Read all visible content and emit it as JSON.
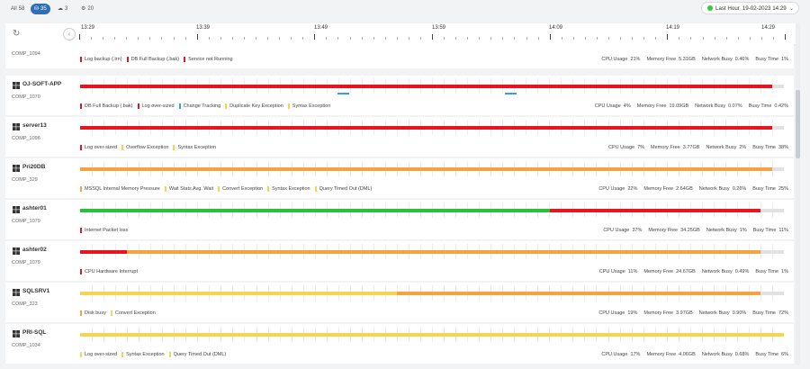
{
  "filters": [
    {
      "label": "All",
      "count": "58",
      "icon": ""
    },
    {
      "label": "",
      "count": "35",
      "icon": "server-icon"
    },
    {
      "label": "",
      "count": "3",
      "icon": "cloud-icon"
    },
    {
      "label": "",
      "count": "20",
      "icon": "database-icon"
    }
  ],
  "timerange": {
    "label": "Last Hour",
    "datetime": "19-02-2023 14:29"
  },
  "timeline": {
    "ticks": [
      "13:29",
      "13:39",
      "13:49",
      "13:59",
      "14:09",
      "14:19",
      "14:29"
    ]
  },
  "colors": {
    "red": "#e8141e",
    "orange": "#f7a240",
    "yellow": "#f6d352",
    "green": "#28c13a",
    "grey": "#e1e1e1",
    "blue": "#3aa0d9"
  },
  "servers": [
    {
      "name": "",
      "comp": "COMP_1094",
      "segments": [],
      "alerts": [
        {
          "label": "Log backup (.trn)",
          "color": "red"
        },
        {
          "label": "DB Full Backup (.bak)",
          "color": "red"
        },
        {
          "label": "Service not Running",
          "color": "red"
        }
      ],
      "stats": {
        "cpu": "21%",
        "memory": "5.31GB",
        "network": "0.46%",
        "busy": "1%"
      }
    },
    {
      "name": "OJ-SOFT-APP",
      "comp": "COMP_1070",
      "segments": [
        {
          "from": 0,
          "to": 0.983,
          "color": "red"
        }
      ],
      "blue": [
        {
          "from": 0.366,
          "to": 0.383
        },
        {
          "from": 0.603,
          "to": 0.62
        }
      ],
      "alerts": [
        {
          "label": "DB Full Backup (.bak)",
          "color": "red"
        },
        {
          "label": "Log over-sized",
          "color": "red"
        },
        {
          "label": "Change Tracking",
          "color": "blue"
        },
        {
          "label": "Duplicate Key Exception",
          "color": "yellow"
        },
        {
          "label": "Syntax Exception",
          "color": "yellow"
        }
      ],
      "stats": {
        "cpu": "4%",
        "memory": "19.09GB",
        "network": "0.07%",
        "busy": "0.42%"
      }
    },
    {
      "name": "server13",
      "comp": "COMP_1096",
      "segments": [
        {
          "from": 0,
          "to": 0.983,
          "color": "red"
        }
      ],
      "alerts": [
        {
          "label": "Log over-sized",
          "color": "red"
        },
        {
          "label": "Overflow Exception",
          "color": "yellow"
        },
        {
          "label": "Syntax Exception",
          "color": "yellow"
        }
      ],
      "stats": {
        "cpu": "7%",
        "memory": "3.77GB",
        "network": "2%",
        "busy": "38%"
      }
    },
    {
      "name": "Pri20DB",
      "comp": "COMP_329",
      "segments": [
        {
          "from": 0,
          "to": 0.983,
          "color": "orange"
        }
      ],
      "alerts": [
        {
          "label": "MSSQL Internal Memory Pressure",
          "color": "orange"
        },
        {
          "label": "Wait Stats Avg. Wait",
          "color": "yellow"
        },
        {
          "label": "Convert Exception",
          "color": "yellow"
        },
        {
          "label": "Syntax Exception",
          "color": "yellow"
        },
        {
          "label": "Query Timed Out (DML)",
          "color": "yellow"
        }
      ],
      "stats": {
        "cpu": "22%",
        "memory": "2.64GB",
        "network": "0.26%",
        "busy": "25%"
      }
    },
    {
      "name": "ashter01",
      "comp": "COMP_1079",
      "segments": [
        {
          "from": 0,
          "to": 0.667,
          "color": "green"
        },
        {
          "from": 0.667,
          "to": 0.967,
          "color": "red"
        }
      ],
      "alerts": [
        {
          "label": "Internet Packet loss",
          "color": "red"
        }
      ],
      "stats": {
        "cpu": "37%",
        "memory": "34.25GB",
        "network": "1%",
        "busy": "11%"
      }
    },
    {
      "name": "ashter02",
      "comp": "COMP_1079",
      "segments": [
        {
          "from": 0,
          "to": 0.067,
          "color": "red"
        },
        {
          "from": 0.067,
          "to": 0.967,
          "color": "orange"
        }
      ],
      "alerts": [
        {
          "label": "CPU Hardware Interrupt",
          "color": "red"
        }
      ],
      "stats": {
        "cpu": "11%",
        "memory": "24.67GB",
        "network": "0.49%",
        "busy": "1%"
      }
    },
    {
      "name": "SQLSRV1",
      "comp": "COMP_323",
      "segments": [
        {
          "from": 0,
          "to": 0.45,
          "color": "yellow"
        },
        {
          "from": 0.45,
          "to": 0.967,
          "color": "orange"
        }
      ],
      "alerts": [
        {
          "label": "Disk busy",
          "color": "orange"
        },
        {
          "label": "Convert Exception",
          "color": "yellow"
        }
      ],
      "stats": {
        "cpu": "19%",
        "memory": "3.97GB",
        "network": "0.90%",
        "busy": "72%"
      }
    },
    {
      "name": "PRI-SQL",
      "comp": "COMP_1034",
      "segments": [
        {
          "from": 0,
          "to": 1.0,
          "color": "yellow"
        }
      ],
      "alerts": [
        {
          "label": "Log over-sized",
          "color": "yellow"
        },
        {
          "label": "Syntax Exception",
          "color": "yellow"
        },
        {
          "label": "Query Timed Out (DML)",
          "color": "yellow"
        }
      ],
      "stats": {
        "cpu": "17%",
        "memory": "4.06GB",
        "network": "0.68%",
        "busy": "6%"
      }
    }
  ],
  "stat_labels": {
    "cpu": "CPU Usage",
    "memory": "Memory Free",
    "network": "Network Busy",
    "busy": "Busy Time"
  }
}
